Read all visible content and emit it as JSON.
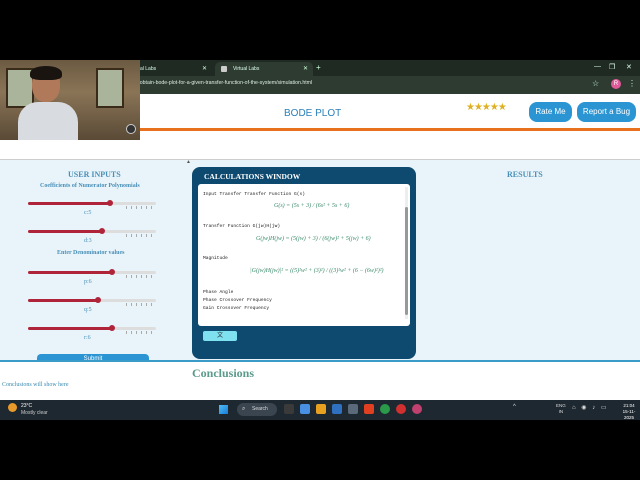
{
  "browser": {
    "tabs": [
      {
        "label": "al Labs"
      },
      {
        "label": "Virtual Labs"
      }
    ],
    "new_tab": "+",
    "url": "-obtain-bode-plot-for-a-given-transfer-function-of-the-system/simulation.html",
    "profile_initial": "R",
    "minimize": "—",
    "maximize": "❐",
    "close": "✕"
  },
  "header": {
    "title": "BODE PLOT",
    "stars": "★★★★★",
    "rating": 4.5,
    "rate_button": "Rate Me",
    "bug_button": "Report a Bug"
  },
  "user_inputs": {
    "title": "USER INPUTS",
    "numerator_heading": "Coefficients of Numerator Polynomials",
    "denominator_heading": "Enter Denominator values",
    "sliders": [
      {
        "label": "c:5",
        "value": 5,
        "max": 6
      },
      {
        "label": "d:3",
        "value": 3,
        "max": 4
      },
      {
        "label": "p:6",
        "value": 6,
        "max": 7
      },
      {
        "label": "q:5",
        "value": 5,
        "max": 7
      },
      {
        "label": "r:6",
        "value": 6,
        "max": 7
      }
    ],
    "submit": "Submit"
  },
  "calc": {
    "title": "CALCULATIONS WINDOW",
    "line1": "Input Transfer Transfer Function G(s)",
    "eq1": "G(s) = (5s + 3) / (6s² + 5s + 6)",
    "line2": "Transfer Function G(jw)H(jw)",
    "eq2": "G(jw)H(jw) = (5(jw) + 3) / (6(jw)² + 5(jw) + 6)",
    "line3": "Magnitude",
    "eq3": "|G(jw)H(jw)|² = ((5)²w² + (3)²) / ((3)²w² + (6 − (6w)²)²)",
    "line4": "Phase Angle",
    "line5": "Phase Crossover Frequency",
    "line6": "Gain Crossover Frequency",
    "button": "文"
  },
  "results": {
    "title": "RESULTS"
  },
  "conclusions": {
    "title": "Conclusions",
    "note": "Conclusions will show here"
  },
  "taskbar": {
    "temp": "23°C",
    "weather": "Mostly clear",
    "search": "Search",
    "lang_top": "ENG",
    "lang_bottom": "IN",
    "time": "21:04",
    "date": "15-11-2025",
    "tray_arrow": "^",
    "sys_icons": "⌂ ◉ ♪ ▭",
    "icon_colors": [
      "#3a3a3a",
      "#4a90e2",
      "#e8a020",
      "#3070c0",
      "#5a6a7a",
      "#e04020",
      "#2a9a4a",
      "#d03030",
      "#c04070"
    ]
  },
  "cam": {
    "icon": "◉"
  }
}
